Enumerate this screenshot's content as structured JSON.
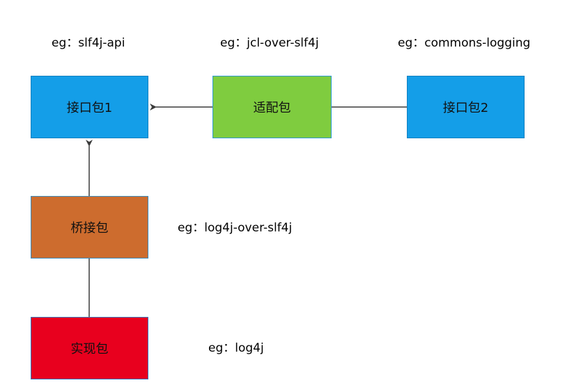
{
  "colors": {
    "interface": "#149ee8",
    "interface_border": "#1280c0",
    "adapter": "#7fcc3f",
    "adapter_border": "#2e9ad0",
    "bridge": "#cd6c2e",
    "bridge_border": "#3a8cc0",
    "impl": "#e8001e",
    "impl_border": "#3a7ac0",
    "arrow": "#3a3a3a"
  },
  "boxes": {
    "interface1": {
      "label": "接口包1"
    },
    "adapter": {
      "label": "适配包"
    },
    "interface2": {
      "label": "接口包2"
    },
    "bridge": {
      "label": "桥接包"
    },
    "impl": {
      "label": "实现包"
    }
  },
  "captions": {
    "api": "eg：slf4j-api",
    "jcl": "eg：jcl-over-slf4j",
    "commons": "eg：commons-logging",
    "bridge": "eg：log4j-over-slf4j",
    "impl": "eg：log4j"
  }
}
